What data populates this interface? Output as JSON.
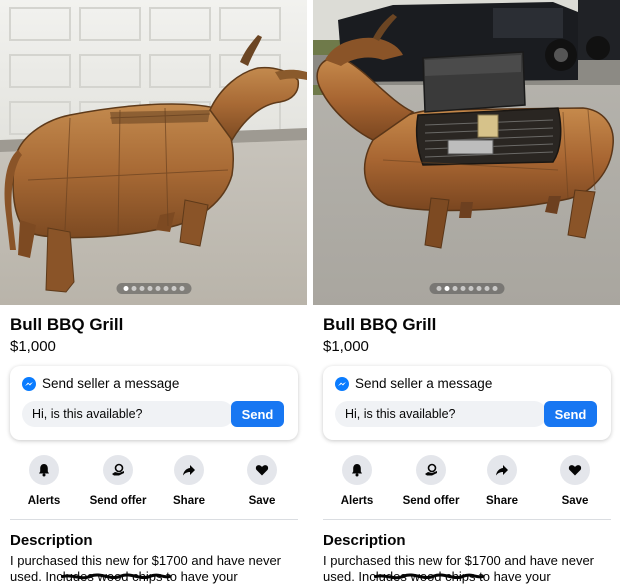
{
  "panels": [
    {
      "title": "Bull BBQ Grill",
      "price": "$1,000",
      "message": {
        "heading": "Send seller a message",
        "input_value": "Hi, is this available?",
        "send_label": "Send"
      },
      "actions": [
        {
          "label": "Alerts",
          "icon": "bell-icon"
        },
        {
          "label": "Send offer",
          "icon": "offer-tag-icon"
        },
        {
          "label": "Share",
          "icon": "share-arrow-icon"
        },
        {
          "label": "Save",
          "icon": "heart-icon"
        }
      ],
      "description": {
        "heading": "Description",
        "text_before": "I purchased this new for $1700 and have never used. Inc",
        "scribbled": "ludes wood chips",
        "text_after": " to have your"
      },
      "carousel": {
        "count": 8,
        "active_index": 0
      }
    },
    {
      "title": "Bull BBQ Grill",
      "price": "$1,000",
      "message": {
        "heading": "Send seller a message",
        "input_value": "Hi, is this available?",
        "send_label": "Send"
      },
      "actions": [
        {
          "label": "Alerts",
          "icon": "bell-icon"
        },
        {
          "label": "Send offer",
          "icon": "offer-tag-icon"
        },
        {
          "label": "Share",
          "icon": "share-arrow-icon"
        },
        {
          "label": "Save",
          "icon": "heart-icon"
        }
      ],
      "description": {
        "heading": "Description",
        "text_before": "I purchased this new for $1700 and have never used. Inc",
        "scribbled": "ludes wood chips",
        "text_after": " to have your"
      },
      "carousel": {
        "count": 8,
        "active_index": 1
      }
    }
  ],
  "colors": {
    "accent": "#1877f2",
    "messenger": "#0a7cff",
    "icon_bg": "#e4e6eb",
    "input_bg": "#f0f2f5",
    "text": "#050505"
  }
}
